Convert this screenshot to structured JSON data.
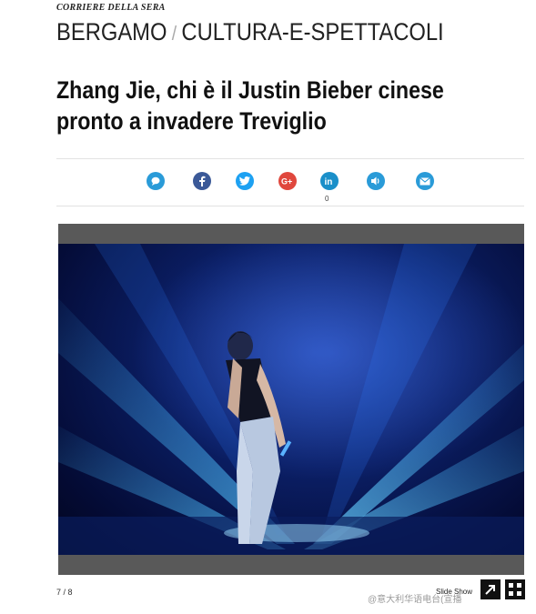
{
  "masthead": {
    "title": "CORRIERE DELLA SERA"
  },
  "breadcrumb": {
    "section": "BERGAMO",
    "separator": "/",
    "subsection": "CULTURA-E-SPETTACOLI"
  },
  "article": {
    "headline": "Zhang Jie, chi è il Justin Bieber cinese pronto a invadere Treviglio"
  },
  "share": {
    "buttons": [
      {
        "name": "comment-icon",
        "color": "#2a9bd8"
      },
      {
        "name": "facebook-icon",
        "color": "#3b5998"
      },
      {
        "name": "twitter-icon",
        "color": "#1da1f2"
      },
      {
        "name": "googleplus-icon",
        "color": "#e0473d"
      },
      {
        "name": "linkedin-icon",
        "color": "#1a8fc9"
      },
      {
        "name": "audio-icon",
        "color": "#2a9bd8"
      },
      {
        "name": "email-icon",
        "color": "#2a9bd8"
      }
    ],
    "linkedin_count": "0"
  },
  "gallery": {
    "counter": "7 / 8",
    "slideshow_label": "Slide Show"
  },
  "watermark": {
    "text": "@意大利华语电台(宣播"
  }
}
